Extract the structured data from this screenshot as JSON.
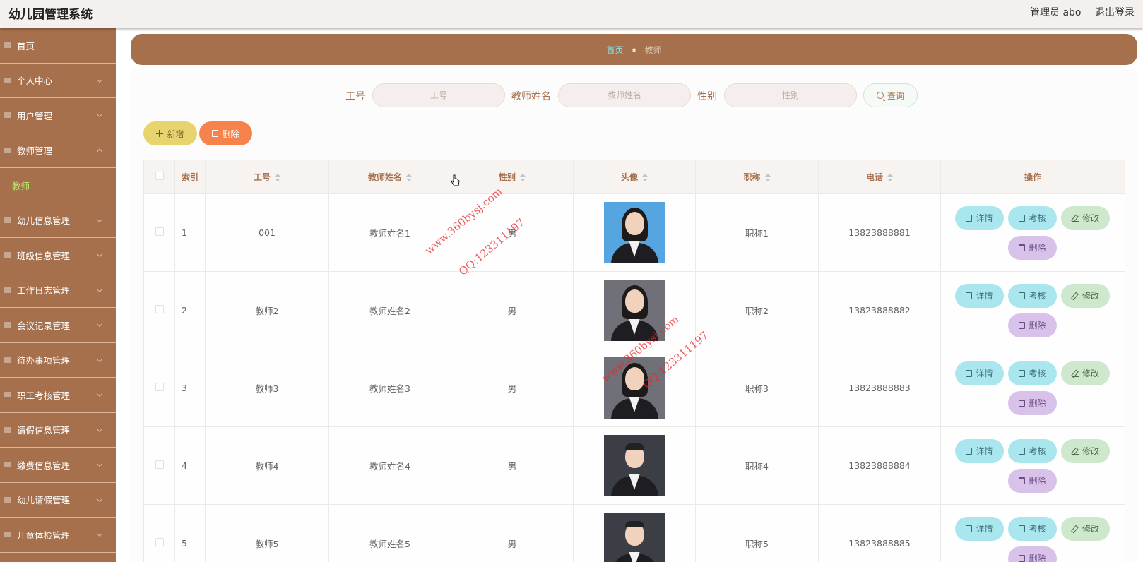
{
  "header": {
    "title": "幼儿园管理系统",
    "admin": "管理员 abo",
    "logout": "退出登录"
  },
  "sidebar": {
    "items": [
      {
        "label": "首页",
        "icon": "home-icon",
        "chevron": false
      },
      {
        "label": "个人中心",
        "icon": "user-icon",
        "chevron": true
      },
      {
        "label": "用户管理",
        "icon": "list-icon",
        "chevron": true
      },
      {
        "label": "教师管理",
        "icon": "book-icon",
        "chevron": true,
        "expanded": true
      },
      {
        "label": "教师",
        "sub": true,
        "active": true
      },
      {
        "label": "幼儿信息管理",
        "icon": "clock-icon",
        "chevron": true
      },
      {
        "label": "班级信息管理",
        "icon": "compass-icon",
        "chevron": true
      },
      {
        "label": "工作日志管理",
        "icon": "list-icon",
        "chevron": true
      },
      {
        "label": "会议记录管理",
        "icon": "monitor-icon",
        "chevron": true
      },
      {
        "label": "待办事项管理",
        "icon": "grid-icon",
        "chevron": true
      },
      {
        "label": "职工考核管理",
        "icon": "flag-icon",
        "chevron": true
      },
      {
        "label": "请假信息管理",
        "icon": "ticket-icon",
        "chevron": true
      },
      {
        "label": "缴费信息管理",
        "icon": "calendar-icon",
        "chevron": true
      },
      {
        "label": "幼儿请假管理",
        "icon": "mail-icon",
        "chevron": true
      },
      {
        "label": "儿童体检管理",
        "icon": "stand-icon",
        "chevron": true
      },
      {
        "label": "",
        "icon": "list-icon",
        "chevron": false
      }
    ]
  },
  "breadcrumb": {
    "home": "首页",
    "separator": "★",
    "current": "教师"
  },
  "search": {
    "fields": [
      {
        "label": "工号",
        "placeholder": "工号"
      },
      {
        "label": "教师姓名",
        "placeholder": "教师姓名"
      },
      {
        "label": "性别",
        "placeholder": "性别"
      }
    ],
    "button": "查询"
  },
  "actions": {
    "add": "新增",
    "delete": "删除"
  },
  "table": {
    "headers": [
      "索引",
      "工号",
      "教师姓名",
      "性别",
      "头像",
      "职称",
      "电话",
      "操作"
    ],
    "rows": [
      {
        "index": "1",
        "id": "001",
        "name": "教师姓名1",
        "gender": "男",
        "title": "职称1",
        "phone": "13823888881",
        "avatar": "female-blue"
      },
      {
        "index": "2",
        "id": "教师2",
        "name": "教师姓名2",
        "gender": "男",
        "title": "职称2",
        "phone": "13823888882",
        "avatar": "female-gray"
      },
      {
        "index": "3",
        "id": "教师3",
        "name": "教师姓名3",
        "gender": "男",
        "title": "职称3",
        "phone": "13823888883",
        "avatar": "female-gray"
      },
      {
        "index": "4",
        "id": "教师4",
        "name": "教师姓名4",
        "gender": "男",
        "title": "职称4",
        "phone": "13823888884",
        "avatar": "male-dark"
      },
      {
        "index": "5",
        "id": "教师5",
        "name": "教师姓名5",
        "gender": "男",
        "title": "职称5",
        "phone": "13823888885",
        "avatar": "male-dark"
      }
    ],
    "ops": {
      "detail": "详情",
      "audit": "考核",
      "edit": "修改",
      "delete": "删除"
    }
  },
  "watermarks": [
    "www.360bysj.com",
    "QQ:123311197"
  ],
  "colors": {
    "accent": "#a6704c",
    "sidebar": "#a6704c",
    "add": "#e8d46f",
    "delete": "#f6834b",
    "detail": "#a9e6ee",
    "edit": "#cde8cc",
    "op_delete": "#d9c2ea"
  }
}
